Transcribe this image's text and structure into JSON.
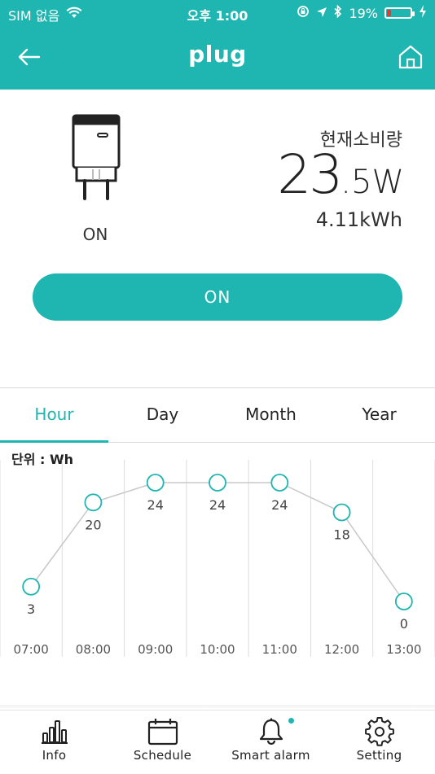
{
  "status_bar": {
    "carrier": "SIM 없음",
    "time": "오후 1:00",
    "battery": "19%",
    "battery_level": 0.19
  },
  "app_bar": {
    "title": "plug"
  },
  "device": {
    "state": "ON",
    "power_label": "현재소비량",
    "power_int": "23",
    "power_frac": ".5W",
    "energy": "4.11kWh",
    "toggle_label": "ON"
  },
  "tabs": [
    {
      "label": "Hour",
      "active": true
    },
    {
      "label": "Day",
      "active": false
    },
    {
      "label": "Month",
      "active": false
    },
    {
      "label": "Year",
      "active": false
    }
  ],
  "chart_data": {
    "type": "line",
    "unit_label": "단위 : Wh",
    "x": [
      "07:00",
      "08:00",
      "09:00",
      "10:00",
      "11:00",
      "12:00",
      "13:00"
    ],
    "values": [
      3,
      20,
      24,
      24,
      24,
      18,
      0
    ],
    "ylim": [
      0,
      24
    ],
    "color": "#1fb5b1",
    "line_color": "#c8c8c8"
  },
  "tabbar": {
    "items": [
      {
        "label": "Info",
        "icon": "bar-chart-icon"
      },
      {
        "label": "Schedule",
        "icon": "calendar-icon"
      },
      {
        "label": "Smart alarm",
        "icon": "bell-icon"
      },
      {
        "label": "Setting",
        "icon": "gear-icon"
      }
    ]
  },
  "colors": {
    "accent": "#1fb5b1",
    "battery_low": "#e53935"
  }
}
